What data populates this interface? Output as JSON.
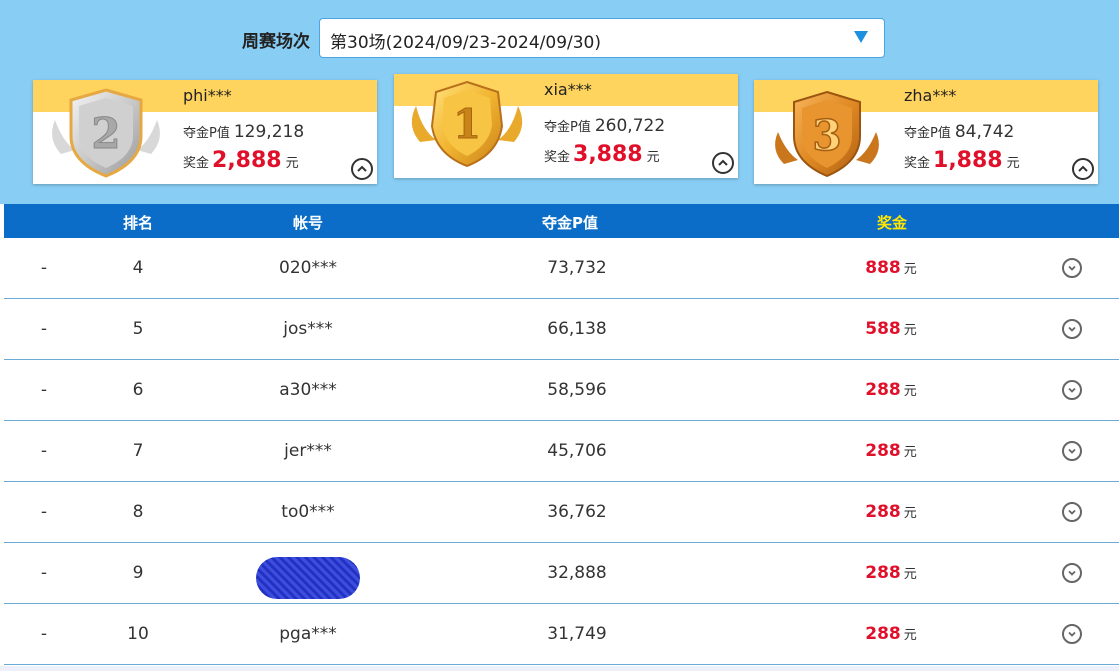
{
  "round_selector": {
    "label": "周赛场次",
    "selected": "第30场(2024/09/23-2024/09/30)"
  },
  "podium": [
    {
      "rank": "2",
      "name": "phi***",
      "score_label": "夺金P值",
      "score": "129,218",
      "prize_label": "奖金",
      "prize": "2,888",
      "unit": "元"
    },
    {
      "rank": "1",
      "name": "xia***",
      "score_label": "夺金P值",
      "score": "260,722",
      "prize_label": "奖金",
      "prize": "3,888",
      "unit": "元"
    },
    {
      "rank": "3",
      "name": "zha***",
      "score_label": "夺金P值",
      "score": "84,742",
      "prize_label": "奖金",
      "prize": "1,888",
      "unit": "元"
    }
  ],
  "table": {
    "headers": {
      "rank": "排名",
      "account": "帐号",
      "score": "夺金P值",
      "prize": "奖金"
    },
    "header_colors": {
      "normal": "#ffffff",
      "prize": "#ffe600"
    },
    "rows": [
      {
        "change": "-",
        "rank": "4",
        "account": "020***",
        "score": "73,732",
        "prize": "888",
        "unit": "元"
      },
      {
        "change": "-",
        "rank": "5",
        "account": "jos***",
        "score": "66,138",
        "prize": "588",
        "unit": "元"
      },
      {
        "change": "-",
        "rank": "6",
        "account": "a30***",
        "score": "58,596",
        "prize": "288",
        "unit": "元"
      },
      {
        "change": "-",
        "rank": "7",
        "account": "jer***",
        "score": "45,706",
        "prize": "288",
        "unit": "元"
      },
      {
        "change": "-",
        "rank": "8",
        "account": "to0***",
        "score": "36,762",
        "prize": "288",
        "unit": "元"
      },
      {
        "change": "-",
        "rank": "9",
        "account": "",
        "score": "32,888",
        "prize": "288",
        "unit": "元",
        "redacted": true
      },
      {
        "change": "-",
        "rank": "10",
        "account": "pga***",
        "score": "31,749",
        "prize": "288",
        "unit": "元"
      }
    ]
  },
  "colors": {
    "top_background": "#88cdf4",
    "header_background": "#0b6dc7",
    "card_band": "#ffd45e",
    "prize_red": "#e0102a",
    "row_divider": "#6aaad4"
  },
  "icons": {
    "select_arrow": "triangle-down-icon",
    "card_toggle": "chevron-up-circle-icon",
    "row_toggle": "chevron-down-circle-icon"
  }
}
